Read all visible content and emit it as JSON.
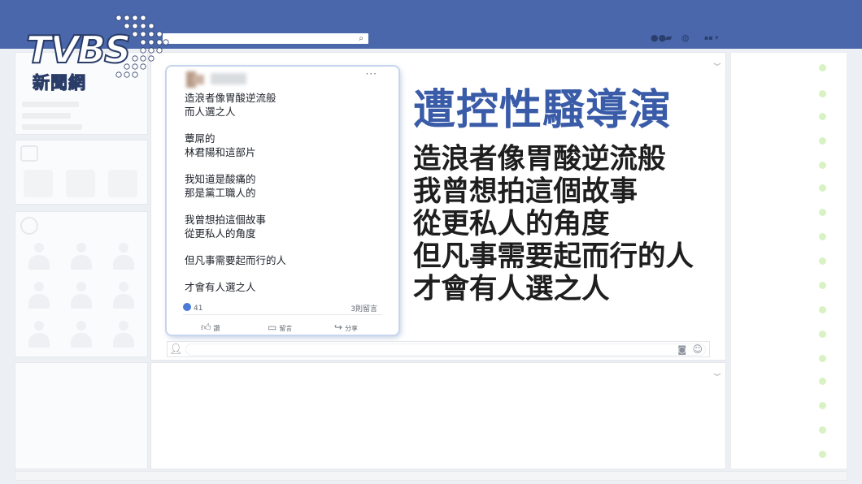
{
  "logo": {
    "brand": "TVBS",
    "subtitle": "新聞網"
  },
  "post": {
    "paragraphs": [
      [
        "造浪者像胃酸逆流般",
        "而人選之人"
      ],
      [
        "蕈屌的",
        "林君陽和這部片"
      ],
      [
        "我知道是酸痛的",
        "那是黨工職人的"
      ],
      [
        "我曾想拍這個故事",
        "從更私人的角度"
      ],
      [
        "但凡事需要起而行的人"
      ],
      [
        "才會有人選之人"
      ]
    ],
    "reaction_count": "41",
    "comment_count": "3則留言",
    "actions": {
      "like": "讚",
      "comment": "留言",
      "share": "分享"
    }
  },
  "caption": {
    "headline": "遭控性騷導演",
    "lines": [
      "造浪者像胃酸逆流般",
      "我曾想拍這個故事",
      "從更私人的角度",
      "但凡事需要起而行的人",
      "才會有人選之人"
    ]
  },
  "icons": {
    "search": "search-icon",
    "friends": "friends-icon",
    "messages": "messages-icon",
    "globe": "globe-icon",
    "more": "more-icon",
    "camera": "camera-icon",
    "smile": "smile-icon"
  },
  "colors": {
    "topbar": "#4a67ab",
    "headline": "#3a5ca8",
    "caption": "#1e1e1e"
  }
}
